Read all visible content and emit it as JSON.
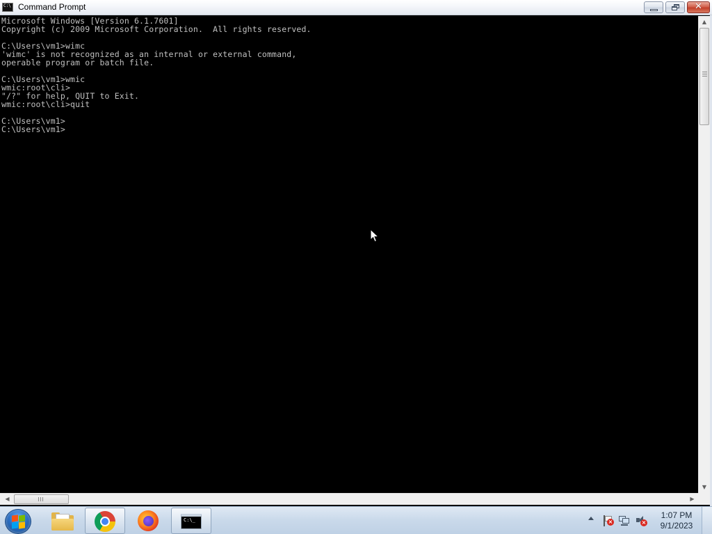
{
  "window": {
    "title": "Command Prompt",
    "icon": "cmd-icon",
    "icon_text": "C:\\",
    "controls": [
      "minimize-icon",
      "restore-icon",
      "close-icon"
    ],
    "close_glyph": "✕"
  },
  "console": {
    "lines": [
      "Microsoft Windows [Version 6.1.7601]",
      "Copyright (c) 2009 Microsoft Corporation.  All rights reserved.",
      "",
      "C:\\Users\\vm1>wimc",
      "'wimc' is not recognized as an internal or external command,",
      "operable program or batch file.",
      "",
      "C:\\Users\\vm1>wmic",
      "wmic:root\\cli>",
      "\"/?\" for help, QUIT to Exit.",
      "wmic:root\\cli>quit",
      "",
      "C:\\Users\\vm1>",
      "C:\\Users\\vm1>"
    ],
    "text_color": "#c0c0c0",
    "background": "#000000"
  },
  "taskbar": {
    "start": "windows-start-orb",
    "pinned": [
      {
        "name": "windows-explorer",
        "icon": "folder-icon"
      },
      {
        "name": "google-chrome",
        "icon": "chrome-icon"
      },
      {
        "name": "mozilla-firefox",
        "icon": "firefox-icon"
      },
      {
        "name": "command-prompt",
        "icon": "cmd-icon",
        "active": true
      }
    ],
    "cmd_icon_text": "C:\\_",
    "tray": {
      "icons": [
        "show-hidden-icons-arrow",
        "action-center-flag-icon",
        "network-icon",
        "volume-muted-icon"
      ],
      "time": "1:07 PM",
      "date": "9/1/2023"
    }
  },
  "scrollbars": {
    "vertical_arrow_up": "▲",
    "vertical_arrow_down": "▼",
    "horizontal_arrow_left": "◀",
    "horizontal_arrow_right": "▶"
  },
  "colors": {
    "console_bg": "#000000",
    "console_fg": "#c0c0c0",
    "close_button": "#c3412b",
    "taskbar": "#c9d9ea"
  }
}
